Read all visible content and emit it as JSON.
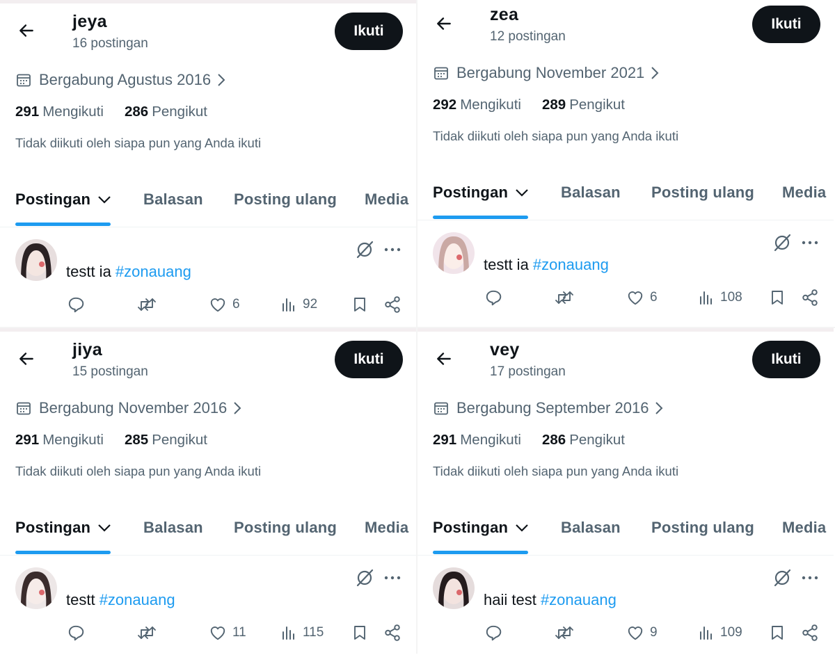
{
  "panels": [
    {
      "name": "jeya",
      "post_count": "16 postingan",
      "follow_label": "Ikuti",
      "joined": "Bergabung Agustus 2016",
      "following_count": "291",
      "following_label": "Mengikuti",
      "followers_count": "286",
      "followers_label": "Pengikut",
      "not_followed_text": "Tidak diikuti oleh siapa pun yang Anda ikuti",
      "tabs": [
        "Postingan",
        "Balasan",
        "Posting ulang",
        "Media"
      ],
      "tweet": {
        "text": "testt ia ",
        "hashtag": "#zonauang",
        "likes": "6",
        "views": "92"
      }
    },
    {
      "name": "zea",
      "post_count": "12 postingan",
      "follow_label": "Ikuti",
      "joined": "Bergabung November 2021",
      "following_count": "292",
      "following_label": "Mengikuti",
      "followers_count": "289",
      "followers_label": "Pengikut",
      "not_followed_text": "Tidak diikuti oleh siapa pun yang Anda ikuti",
      "tabs": [
        "Postingan",
        "Balasan",
        "Posting ulang",
        "Media"
      ],
      "tweet": {
        "text": "testt ia ",
        "hashtag": "#zonauang",
        "likes": "6",
        "views": "108"
      }
    },
    {
      "name": "jiya",
      "post_count": "15 postingan",
      "follow_label": "Ikuti",
      "joined": "Bergabung November 2016",
      "following_count": "291",
      "following_label": "Mengikuti",
      "followers_count": "285",
      "followers_label": "Pengikut",
      "not_followed_text": "Tidak diikuti oleh siapa pun yang Anda ikuti",
      "tabs": [
        "Postingan",
        "Balasan",
        "Posting ulang",
        "Media"
      ],
      "tweet": {
        "text": "testt ",
        "hashtag": "#zonauang",
        "likes": "11",
        "views": "115"
      }
    },
    {
      "name": "vey",
      "post_count": "17 postingan",
      "follow_label": "Ikuti",
      "joined": "Bergabung September 2016",
      "following_count": "291",
      "following_label": "Mengikuti",
      "followers_count": "286",
      "followers_label": "Pengikut",
      "not_followed_text": "Tidak diikuti oleh siapa pun yang Anda ikuti",
      "tabs": [
        "Postingan",
        "Balasan",
        "Posting ulang",
        "Media"
      ],
      "tweet": {
        "text": "haii test ",
        "hashtag": "#zonauang",
        "likes": "9",
        "views": "109"
      }
    }
  ],
  "colors": {
    "accent": "#1d9bf0",
    "text": "#0f1419",
    "muted": "#536471",
    "button": "#0f1419"
  },
  "icons": [
    "back-arrow-icon",
    "calendar-icon",
    "chevron-right-icon",
    "chevron-down-icon",
    "grok-icon",
    "more-icon",
    "reply-icon",
    "repost-icon",
    "like-icon",
    "views-icon",
    "bookmark-icon",
    "share-icon"
  ]
}
